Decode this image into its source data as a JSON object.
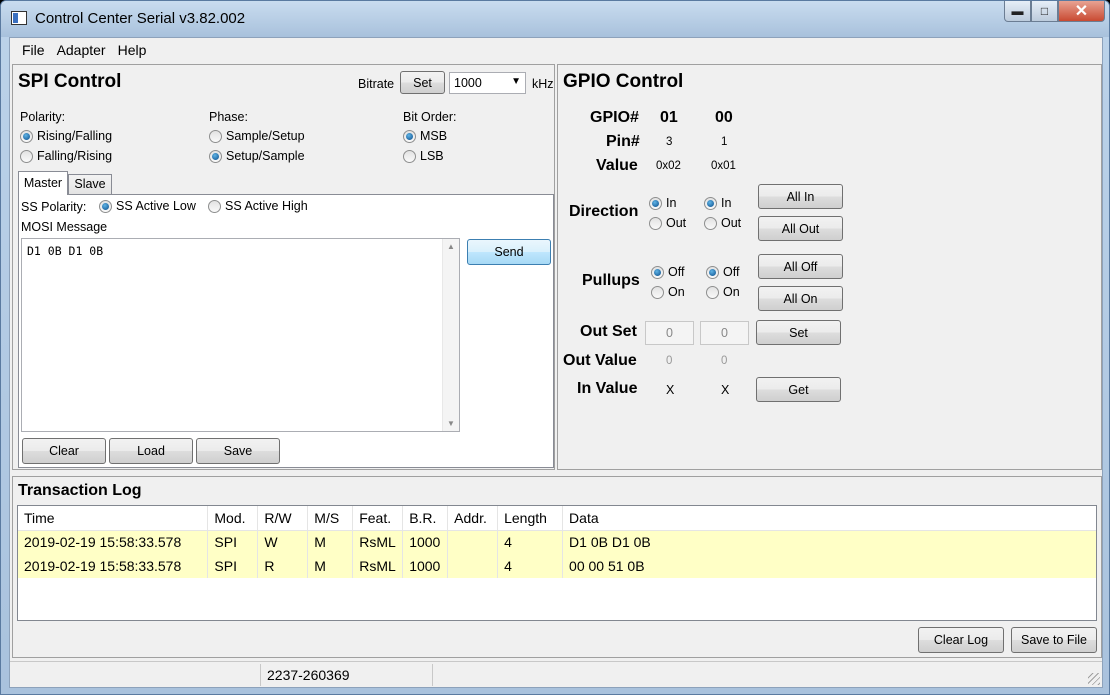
{
  "window": {
    "title": "Control Center Serial v3.82.002"
  },
  "menu": [
    "File",
    "Adapter",
    "Help"
  ],
  "spi": {
    "title": "SPI Control",
    "bitrate_label": "Bitrate",
    "set_label": "Set",
    "bitrate_value": "1000",
    "unit": "kHz",
    "polarity": {
      "label": "Polarity:",
      "options": [
        "Rising/Falling",
        "Falling/Rising"
      ],
      "selected": 0
    },
    "phase": {
      "label": "Phase:",
      "options": [
        "Sample/Setup",
        "Setup/Sample"
      ],
      "selected": 1
    },
    "bit_order": {
      "label": "Bit Order:",
      "options": [
        "MSB",
        "LSB"
      ],
      "selected": 0
    },
    "tabs": [
      "Master",
      "Slave"
    ],
    "active_tab": "Master",
    "ss_polarity_label": "SS Polarity:",
    "ss_options": [
      "SS Active Low",
      "SS Active High"
    ],
    "ss_selected": 0,
    "mosi_label": "MOSI Message",
    "mosi_value": "D1 0B D1 0B",
    "send_label": "Send",
    "clear_label": "Clear",
    "load_label": "Load",
    "save_label": "Save"
  },
  "gpio": {
    "title": "GPIO Control",
    "gpio_label": "GPIO#",
    "pin_label": "Pin#",
    "value_label": "Value",
    "columns": [
      {
        "gpio": "01",
        "pin": "3",
        "value": "0x02",
        "out_set": "0",
        "out_value": "0",
        "in_value": "X"
      },
      {
        "gpio": "00",
        "pin": "1",
        "value": "0x01",
        "out_set": "0",
        "out_value": "0",
        "in_value": "X"
      }
    ],
    "direction_label": "Direction",
    "direction_options": [
      "In",
      "Out"
    ],
    "pullups_label": "Pullups",
    "pullup_options": [
      "Off",
      "On"
    ],
    "all_in": "All In",
    "all_out": "All Out",
    "all_off": "All Off",
    "all_on": "All On",
    "out_set_label": "Out Set",
    "set_label": "Set",
    "out_value_label": "Out Value",
    "in_value_label": "In Value",
    "get_label": "Get"
  },
  "log": {
    "title": "Transaction Log",
    "columns": [
      "Time",
      "Mod.",
      "R/W",
      "M/S",
      "Feat.",
      "B.R.",
      "Addr.",
      "Length",
      "Data"
    ],
    "rows": [
      [
        "2019-02-19 15:58:33.578",
        "SPI",
        "W",
        "M",
        "RsML",
        "1000",
        "",
        "4",
        "D1 0B D1 0B"
      ],
      [
        "2019-02-19 15:58:33.578",
        "SPI",
        "R",
        "M",
        "RsML",
        "1000",
        "",
        "4",
        "00 00 51 0B"
      ]
    ],
    "clear_label": "Clear Log",
    "save_label": "Save to File"
  },
  "status": {
    "serial": "2237-260369"
  }
}
